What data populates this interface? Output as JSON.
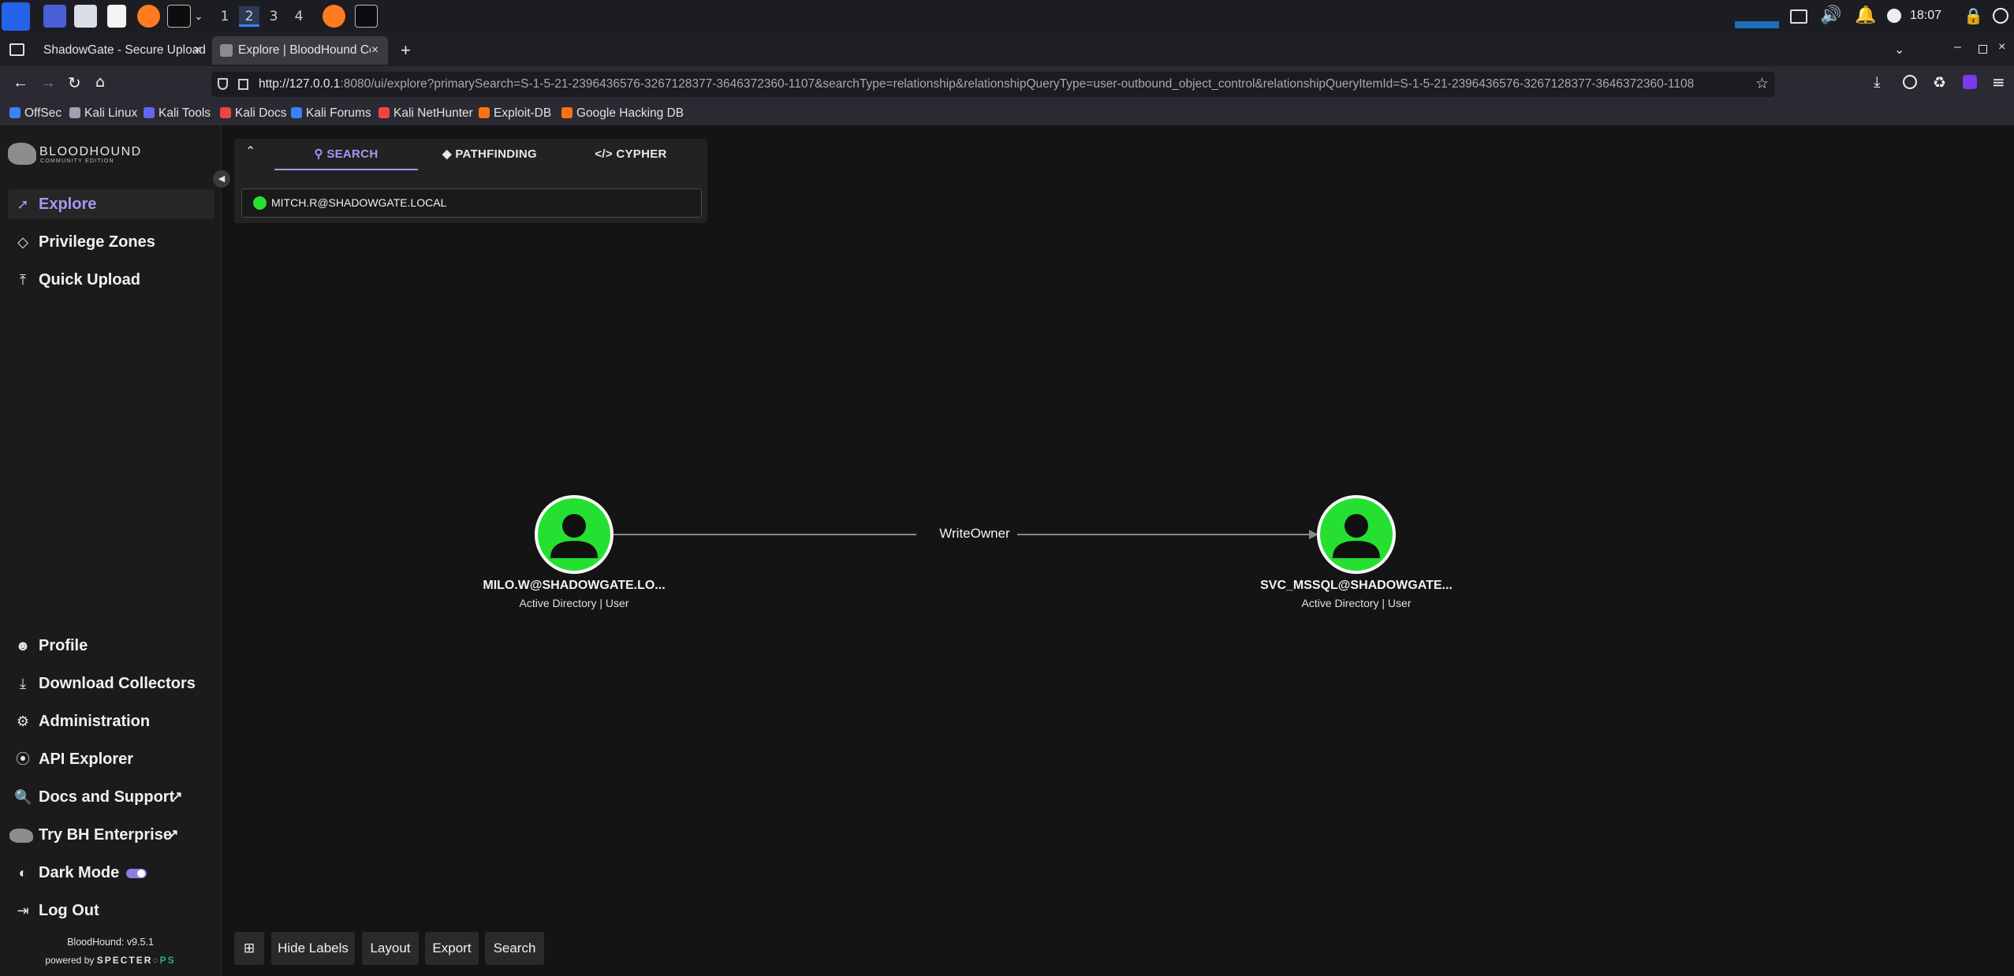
{
  "taskbar": {
    "workspaces": [
      "1",
      "2",
      "3",
      "4"
    ],
    "time": "18:07"
  },
  "browser": {
    "tabs": [
      {
        "title": "ShadowGate - Secure Upload"
      },
      {
        "title": "Explore | BloodHound Co"
      }
    ],
    "url_host": "http://127.0.0.1",
    "url_rest": ":8080/ui/explore?primarySearch=S-1-5-21-2396436576-3267128377-3646372360-1107&searchType=relationship&relationshipQueryType=user-outbound_object_control&relationshipQueryItemId=S-1-5-21-2396436576-3267128377-3646372360-1108",
    "bookmarks": [
      "OffSec",
      "Kali Linux",
      "Kali Tools",
      "Kali Docs",
      "Kali Forums",
      "Kali NetHunter",
      "Exploit-DB",
      "Google Hacking DB"
    ],
    "bookmark_colors": [
      "#3b82f6",
      "#9ca3af",
      "#6366f1",
      "#ef4444",
      "#3b82f6",
      "#ef4444",
      "#f97316",
      "#f97316"
    ]
  },
  "app": {
    "logo_title": "BLOODHOUND",
    "logo_subtitle": "COMMUNITY EDITION",
    "nav_top": [
      {
        "label": "Explore",
        "icon": "trend-icon"
      },
      {
        "label": "Privilege Zones",
        "icon": "gem-icon"
      },
      {
        "label": "Quick Upload",
        "icon": "upload-icon"
      }
    ],
    "nav_bottom": [
      {
        "label": "Profile",
        "icon": "person-icon"
      },
      {
        "label": "Download Collectors",
        "icon": "download-icon"
      },
      {
        "label": "Administration",
        "icon": "admin-icon"
      },
      {
        "label": "API Explorer",
        "icon": "compass-icon"
      },
      {
        "label": "Docs and Support",
        "icon": "docs-icon"
      },
      {
        "label": "Try BH Enterprise",
        "icon": "bloodhound-icon"
      },
      {
        "label": "Dark Mode",
        "icon": "contrast-icon"
      },
      {
        "label": "Log Out",
        "icon": "logout-icon"
      }
    ],
    "version": "BloodHound: v9.5.1",
    "powered_by": "powered by",
    "vendor": "SPECTER",
    "vendor_suffix": "PS",
    "accent_color": "#a996f2"
  },
  "search_panel": {
    "tabs": [
      "SEARCH",
      "PATHFINDING",
      "CYPHER"
    ],
    "active_tab": "SEARCH",
    "search_value": "MITCH.R@SHADOWGATE.LOCAL"
  },
  "graph": {
    "nodes": [
      {
        "label": "MILO.W@SHADOWGATE.LO...",
        "type": "Active Directory | User"
      },
      {
        "label": "SVC_MSSQL@SHADOWGATE...",
        "type": "Active Directory | User"
      }
    ],
    "edge_label": "WriteOwner",
    "node_color": "#26e031"
  },
  "toolbar": {
    "hide_labels": "Hide Labels",
    "layout": "Layout",
    "export": "Export",
    "search": "Search"
  }
}
